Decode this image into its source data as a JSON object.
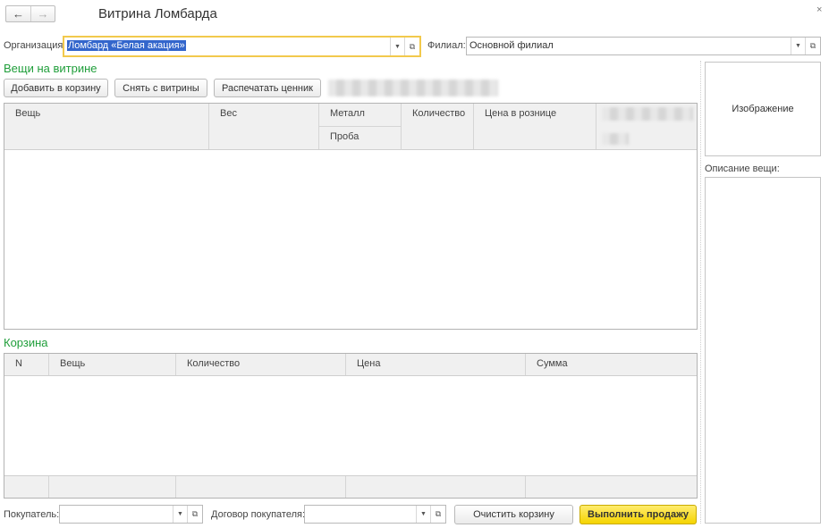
{
  "window": {
    "title": "Витрина Ломбарда",
    "close_glyph": "×",
    "nav_back": "←",
    "nav_forward": "→"
  },
  "header": {
    "org_label": "Организация:",
    "org_value": "Ломбард «Белая акация»",
    "branch_label": "Филиал:",
    "branch_value": "Основной филиал"
  },
  "showcase": {
    "title": "Вещи на витрине",
    "add_button": "Добавить в корзину",
    "remove_button": "Снять с витрины",
    "print_button": "Распечатать ценник",
    "columns": {
      "item": "Вещь",
      "weight": "Вес",
      "metal": "Металл",
      "probe": "Проба",
      "quantity": "Количество",
      "price": "Цена в рознице"
    }
  },
  "cart": {
    "title": "Корзина",
    "columns": [
      "N",
      "Вещь",
      "Количество",
      "Цена",
      "Сумма"
    ]
  },
  "side": {
    "image_label": "Изображение",
    "description_label": "Описание вещи:"
  },
  "footer": {
    "buyer_label": "Покупатель:",
    "contract_label": "Договор покупателя:",
    "clear_button": "Очистить корзину",
    "sell_button": "Выполнить продажу"
  }
}
